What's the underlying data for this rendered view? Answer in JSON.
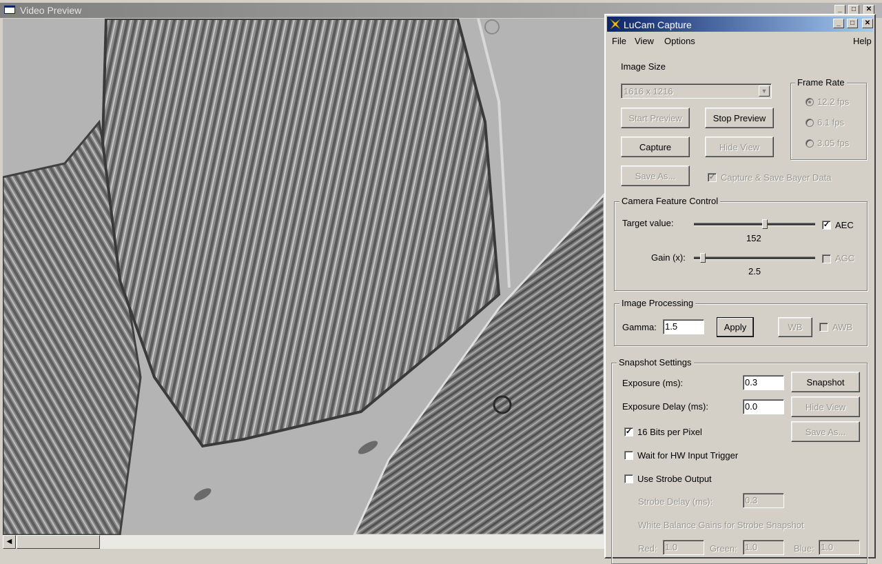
{
  "video_preview": {
    "title": "Video Preview",
    "window_controls": {
      "minimize": "_",
      "maximize": "□",
      "close": "✕"
    },
    "scroll_left_arrow": "◀"
  },
  "lucam": {
    "title": "LuCam Capture",
    "window_controls": {
      "minimize": "_",
      "maximize": "□",
      "close": "✕"
    },
    "menu": {
      "file": "File",
      "view": "View",
      "options": "Options",
      "help": "Help"
    },
    "image_size": {
      "label": "Image Size",
      "selected": "1616 x 1216",
      "dropdown_arrow": "▼"
    },
    "frame_rate": {
      "title": "Frame Rate",
      "options": [
        "12.2 fps",
        "6.1 fps",
        "3.05 fps"
      ],
      "selected_index": 0
    },
    "buttons": {
      "start_preview": "Start Preview",
      "stop_preview": "Stop Preview",
      "capture": "Capture",
      "hide_view": "Hide View",
      "save_as": "Save As..."
    },
    "capture_bayer": {
      "label": "Capture & Save Bayer Data",
      "checked": true
    },
    "camera_feature": {
      "title": "Camera Feature Control",
      "target_label": "Target value:",
      "target_value": "152",
      "aec_label": "AEC",
      "aec_checked": true,
      "gain_label": "Gain (x):",
      "gain_value": "2.5",
      "agc_label": "AGC",
      "agc_checked": false,
      "checkmark": "✓"
    },
    "image_processing": {
      "title": "Image Processing",
      "gamma_label": "Gamma:",
      "gamma_value": "1.5",
      "apply": "Apply",
      "wb": "WB",
      "awb_label": "AWB"
    },
    "snapshot": {
      "title": "Snapshot Settings",
      "exposure_label": "Exposure (ms):",
      "exposure_value": "0.3",
      "snapshot_button": "Snapshot",
      "exposure_delay_label": "Exposure Delay (ms):",
      "exposure_delay_value": "0.0",
      "hide_view": "Hide View",
      "save_as": "Save As...",
      "bits16_label": "16 Bits per Pixel",
      "bits16_checked": true,
      "hw_trigger_label": "Wait for HW Input Trigger",
      "strobe_label": "Use Strobe Output",
      "strobe_delay_label": "Strobe Delay (ms):",
      "strobe_delay_value": "0.3",
      "wb_gains_label": "White Balance Gains for Strobe Snapshot",
      "red_label": "Red:",
      "red_value": "1.0",
      "green_label": "Green:",
      "green_value": "1.0",
      "blue_label": "Blue:",
      "blue_value": "1.0"
    }
  }
}
